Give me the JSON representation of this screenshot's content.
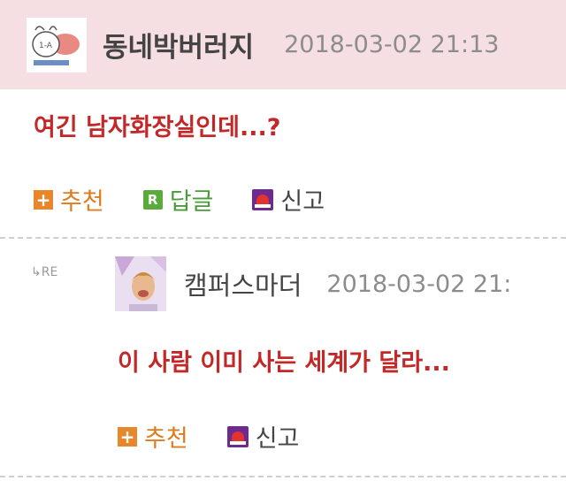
{
  "comment": {
    "author": "동네박버러지",
    "date": "2018-03-02 21:13",
    "text": "여긴 남자화장실인데...?",
    "actions": {
      "recommend": "추천",
      "reply": "답글",
      "report": "신고"
    },
    "reply_icon_letter": "R",
    "plus_icon_glyph": "+"
  },
  "reply": {
    "marker": "↳RE",
    "author": "캠퍼스마더",
    "date": "2018-03-02 21:",
    "text": "이 사람 이미 사는 세계가 달라...",
    "actions": {
      "recommend": "추천",
      "report": "신고"
    }
  },
  "colors": {
    "header_bg": "#f6dfe2",
    "comment_text": "#c22828",
    "recommend_icon": "#e8862a",
    "reply_icon": "#5aaa3c",
    "report_icon": "#6e2a8e"
  },
  "icons": [
    "avatar-pig-icon",
    "plus-icon",
    "reply-r-icon",
    "siren-icon",
    "reply-arrow-icon"
  ]
}
